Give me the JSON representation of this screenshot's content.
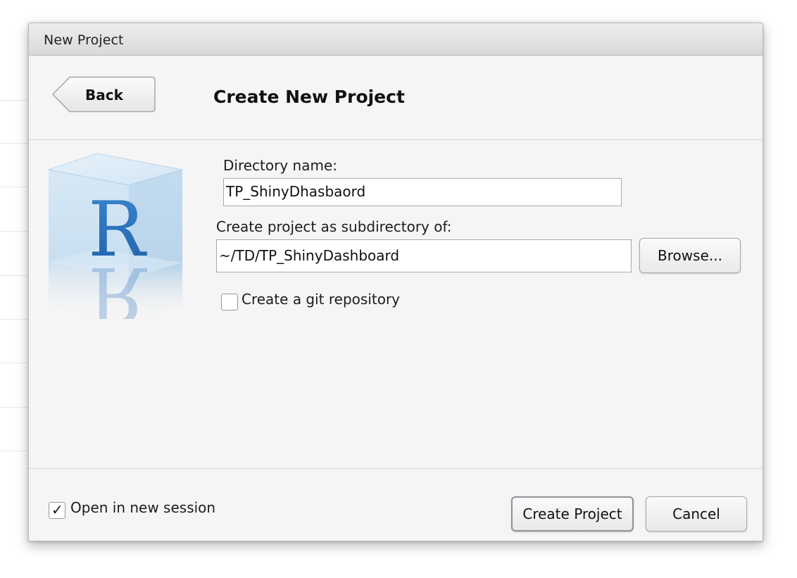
{
  "window": {
    "title": "New Project"
  },
  "header": {
    "back_label": "Back",
    "title": "Create New Project"
  },
  "form": {
    "directory_label": "Directory name:",
    "directory_value": "TP_ShinyDhasbaord",
    "parent_label": "Create project as subdirectory of:",
    "parent_value": "~/TD/TP_ShinyDashboard",
    "browse_label": "Browse...",
    "git_label": "Create a git repository",
    "git_checked": false
  },
  "footer": {
    "new_session_label": "Open in new session",
    "new_session_checked": true,
    "new_session_mark": "✓",
    "create_label": "Create Project",
    "cancel_label": "Cancel"
  },
  "logo": {
    "icon": "r-logo-icon",
    "letter": "R"
  },
  "colors": {
    "dialog_bg": "#f5f5f5",
    "logo_blue": "#2a6fbd"
  }
}
